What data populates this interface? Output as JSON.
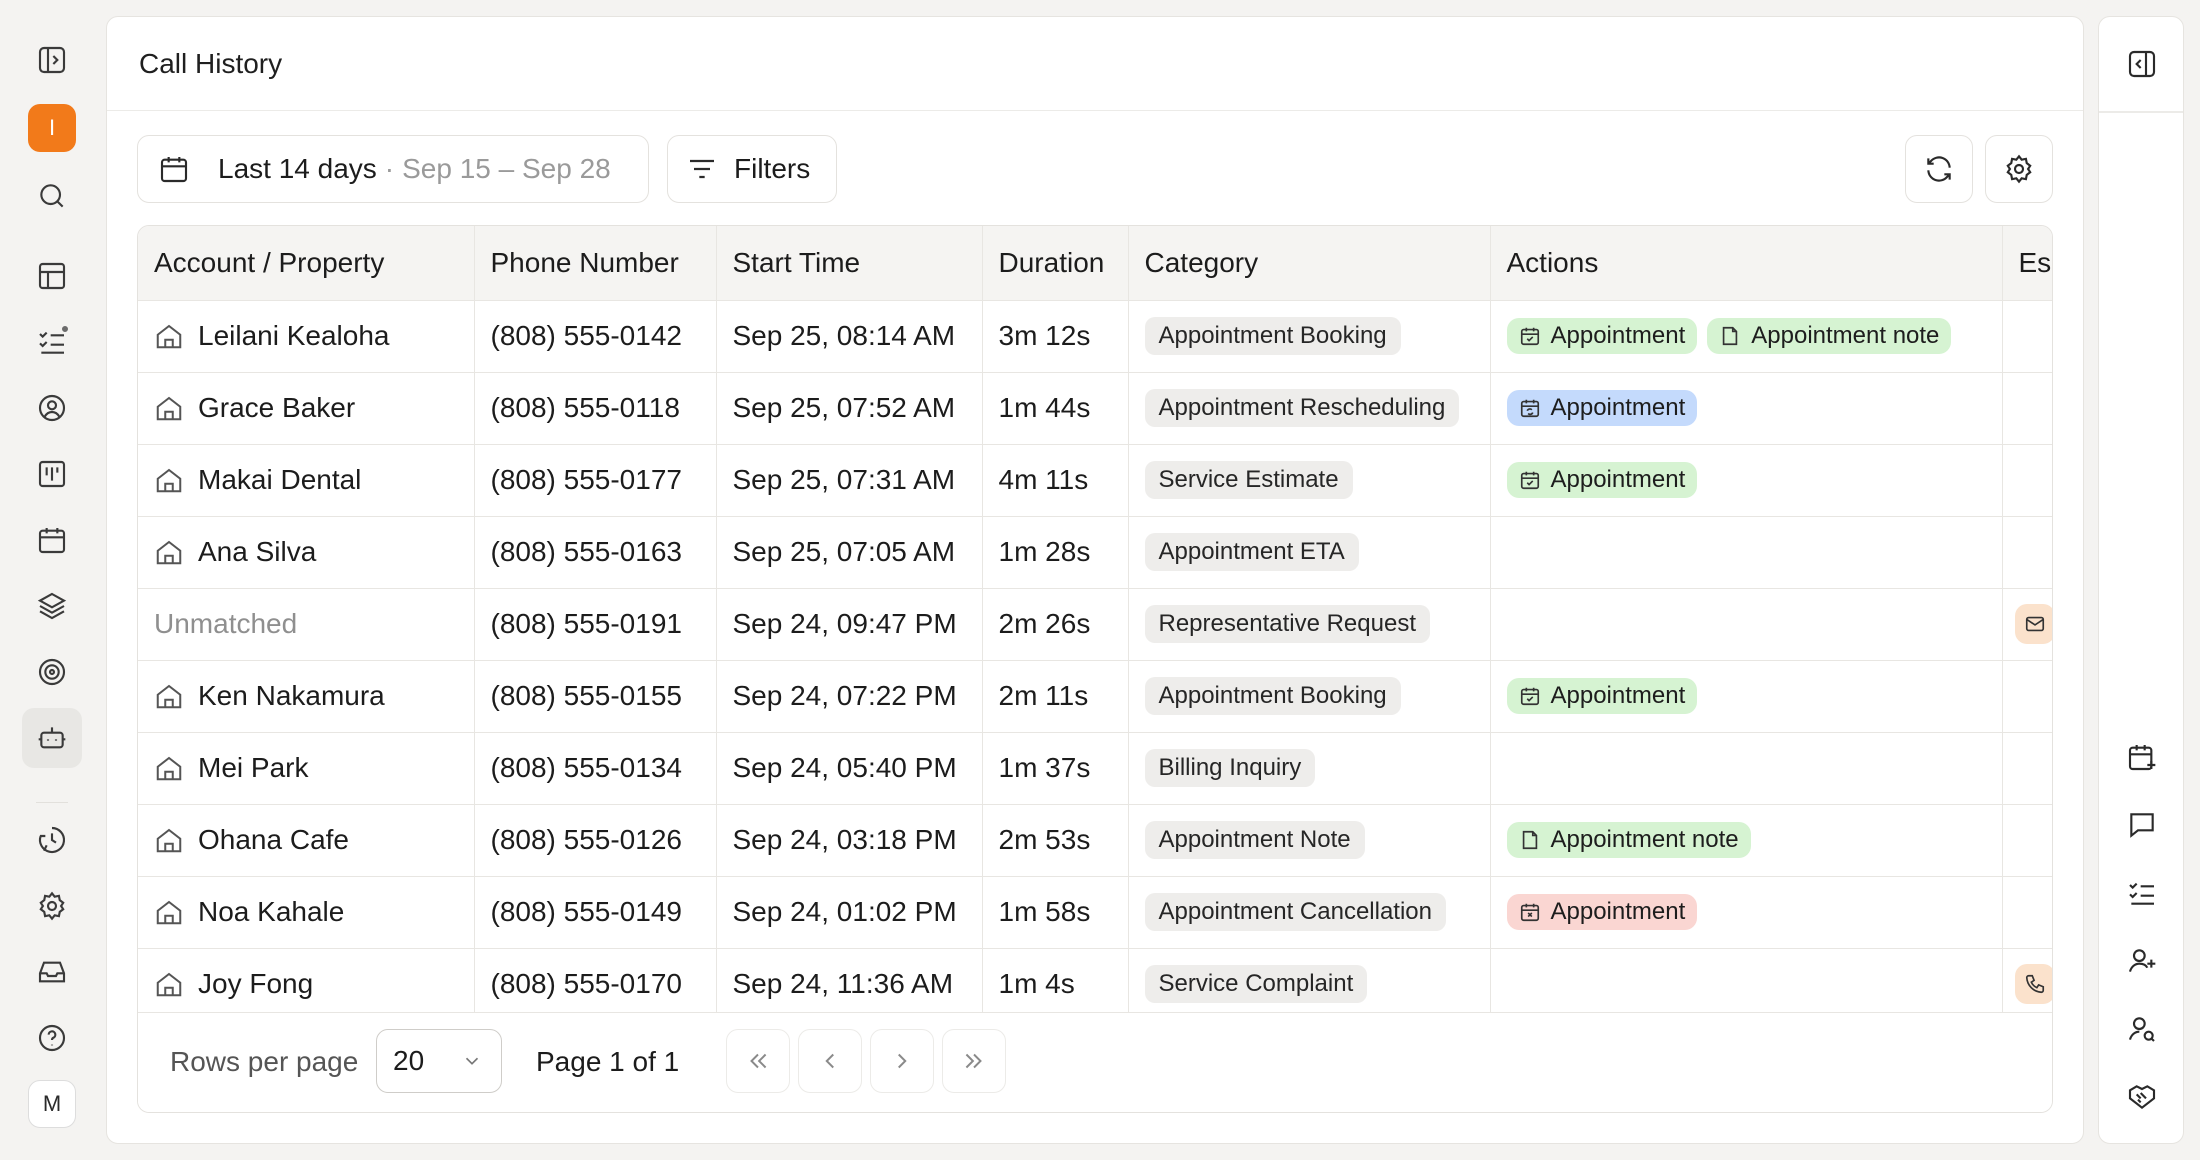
{
  "sidebar": {
    "org_initial": "I",
    "user_initial": "M",
    "icons": [
      "sidebar-toggle-icon",
      "search-icon",
      "layout-icon",
      "tasks-icon",
      "contacts-icon",
      "board-icon",
      "calendar-icon",
      "layers-icon",
      "target-icon",
      "bot-icon",
      "history-icon",
      "settings-icon",
      "inbox-icon",
      "help-icon"
    ]
  },
  "header": {
    "title": "Call History"
  },
  "toolbar": {
    "date_preset": "Last 14 days",
    "date_separator": "·",
    "date_range": "Sep 15 – Sep 28",
    "filters_label": "Filters"
  },
  "table": {
    "columns": [
      "Account / Property",
      "Phone Number",
      "Start Time",
      "Duration",
      "Category",
      "Actions",
      "Es"
    ],
    "rows": [
      {
        "account": "Leilani Kealoha",
        "phone": "(808) 555-0142",
        "start": "Sep 25, 08:14 AM",
        "duration": "3m 12s",
        "category": "Appointment Booking",
        "actions": [
          {
            "label": "Appointment",
            "color": "green",
            "icon": "calendar-check-icon"
          },
          {
            "label": "Appointment note",
            "color": "green",
            "icon": "note-icon"
          }
        ],
        "escalation": null
      },
      {
        "account": "Grace Baker",
        "phone": "(808) 555-0118",
        "start": "Sep 25, 07:52 AM",
        "duration": "1m 44s",
        "category": "Appointment Rescheduling",
        "actions": [
          {
            "label": "Appointment",
            "color": "blue",
            "icon": "calendar-sync-icon"
          }
        ],
        "escalation": null
      },
      {
        "account": "Makai Dental",
        "phone": "(808) 555-0177",
        "start": "Sep 25, 07:31 AM",
        "duration": "4m 11s",
        "category": "Service Estimate",
        "actions": [
          {
            "label": "Appointment",
            "color": "green",
            "icon": "calendar-check-icon"
          }
        ],
        "escalation": null
      },
      {
        "account": "Ana Silva",
        "phone": "(808) 555-0163",
        "start": "Sep 25, 07:05 AM",
        "duration": "1m 28s",
        "category": "Appointment ETA",
        "actions": [],
        "escalation": null
      },
      {
        "account": "Unmatched",
        "unmatched": true,
        "phone": "(808) 555-0191",
        "start": "Sep 24, 09:47 PM",
        "duration": "2m 26s",
        "category": "Representative Request",
        "actions": [],
        "escalation": "mail-icon"
      },
      {
        "account": "Ken Nakamura",
        "phone": "(808) 555-0155",
        "start": "Sep 24, 07:22 PM",
        "duration": "2m 11s",
        "category": "Appointment Booking",
        "actions": [
          {
            "label": "Appointment",
            "color": "green",
            "icon": "calendar-check-icon"
          }
        ],
        "escalation": null
      },
      {
        "account": "Mei Park",
        "phone": "(808) 555-0134",
        "start": "Sep 24, 05:40 PM",
        "duration": "1m 37s",
        "category": "Billing Inquiry",
        "actions": [],
        "escalation": null
      },
      {
        "account": "Ohana Cafe",
        "phone": "(808) 555-0126",
        "start": "Sep 24, 03:18 PM",
        "duration": "2m 53s",
        "category": "Appointment Note",
        "actions": [
          {
            "label": "Appointment note",
            "color": "green",
            "icon": "note-icon"
          }
        ],
        "escalation": null
      },
      {
        "account": "Noa Kahale",
        "phone": "(808) 555-0149",
        "start": "Sep 24, 01:02 PM",
        "duration": "1m 58s",
        "category": "Appointment Cancellation",
        "actions": [
          {
            "label": "Appointment",
            "color": "red",
            "icon": "calendar-x-icon"
          }
        ],
        "escalation": null
      },
      {
        "account": "Joy Fong",
        "phone": "(808) 555-0170",
        "start": "Sep 24, 11:36 AM",
        "duration": "1m 4s",
        "category": "Service Complaint",
        "actions": [],
        "escalation": "phone-icon"
      }
    ]
  },
  "pagination": {
    "rows_per_page_label": "Rows per page",
    "rows_per_page_value": "20",
    "page_label": "Page 1 of 1"
  },
  "right_rail": {
    "icons": [
      "panel-toggle-icon",
      "calendar-plus-icon",
      "message-icon",
      "checklist-icon",
      "user-plus-icon",
      "user-search-icon",
      "handshake-icon"
    ]
  },
  "colors": {
    "accent": "#f27a1a",
    "action_green": "#d6f3d2",
    "action_blue": "#c4dafc",
    "action_red": "#fad6d2",
    "escalation": "#fbe2cc"
  }
}
